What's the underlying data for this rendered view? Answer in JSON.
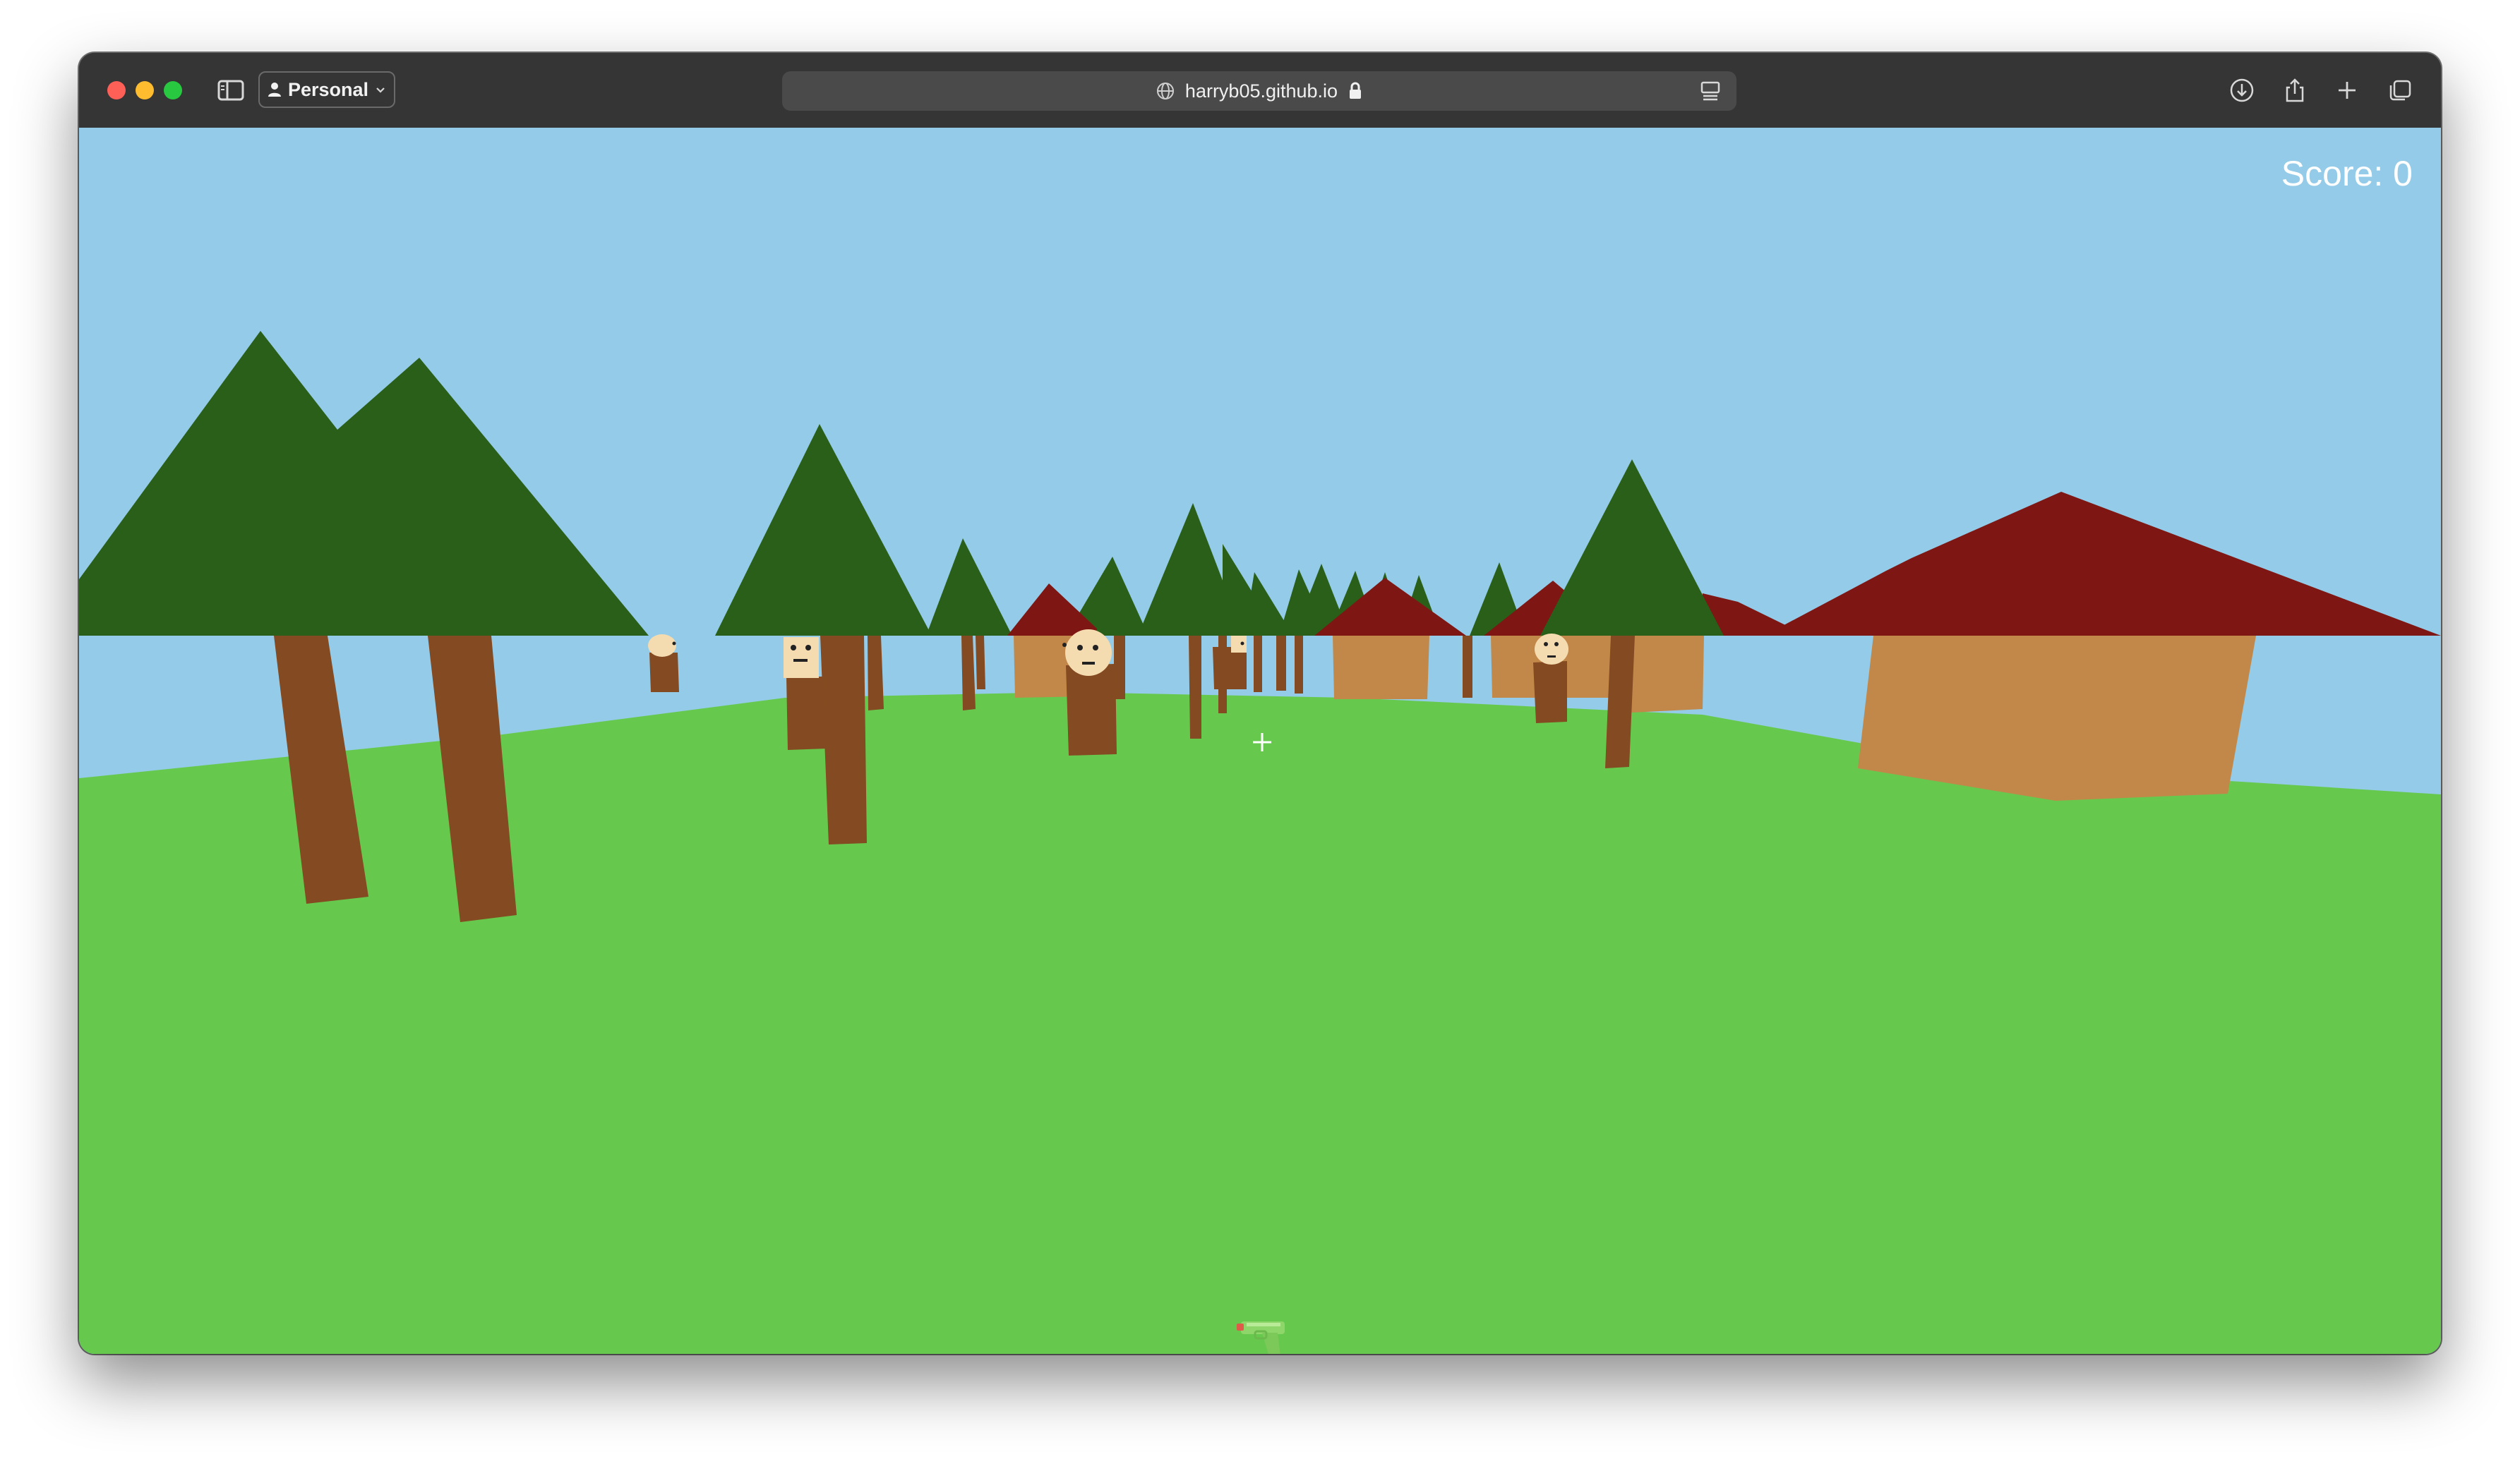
{
  "browser": {
    "profile_label": "Personal",
    "url": "harryb05.github.io",
    "icons": [
      "sidebar-icon",
      "person-icon",
      "chevron-down-icon",
      "globe-icon",
      "lock-icon",
      "reader-icon",
      "download-icon",
      "share-icon",
      "plus-icon",
      "tabs-icon"
    ]
  },
  "game": {
    "score_label": "Score: 0",
    "crosshair": "+",
    "weapon": "water-pistol"
  },
  "colors": {
    "sky": "#94cbe8",
    "grass": "#66c94e",
    "tree_foliage": "#2a5f1a",
    "trunk": "#844a21",
    "roof": "#7e1713",
    "house_wall": "#c2884a",
    "face": "#f5dcb0"
  }
}
